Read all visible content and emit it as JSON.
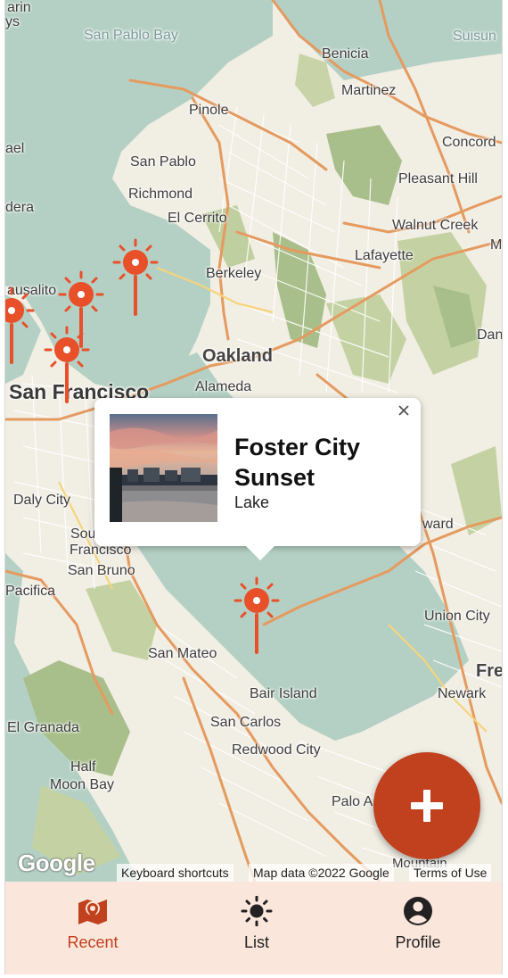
{
  "map": {
    "places": [
      {
        "label": "arin",
        "cls": "sm"
      },
      {
        "label": "ys",
        "cls": "sm"
      },
      {
        "label": "San Pablo Bay",
        "cls": "sm water"
      },
      {
        "label": "Suisun",
        "cls": "sm water"
      },
      {
        "label": "Benicia",
        "cls": "sm"
      },
      {
        "label": "Martinez",
        "cls": "sm"
      },
      {
        "label": "Pinole",
        "cls": "sm"
      },
      {
        "label": "Concord",
        "cls": "sm"
      },
      {
        "label": "ael",
        "cls": "sm"
      },
      {
        "label": "San Pablo",
        "cls": "sm"
      },
      {
        "label": "Pleasant Hill",
        "cls": "sm"
      },
      {
        "label": "Richmond",
        "cls": "sm"
      },
      {
        "label": "dera",
        "cls": "sm"
      },
      {
        "label": "El Cerrito",
        "cls": "sm"
      },
      {
        "label": "Walnut Creek",
        "cls": "sm"
      },
      {
        "label": "M",
        "cls": "sm"
      },
      {
        "label": "Lafayette",
        "cls": "sm"
      },
      {
        "label": "ausalito",
        "cls": "sm"
      },
      {
        "label": "Berkeley",
        "cls": "sm"
      },
      {
        "label": "Dan",
        "cls": "sm"
      },
      {
        "label": "Oakland",
        "cls": "mid"
      },
      {
        "label": "San Francisco",
        "cls": "big"
      },
      {
        "label": "Alameda",
        "cls": "sm"
      },
      {
        "label": "Daly City",
        "cls": "sm"
      },
      {
        "label": "ward",
        "cls": "sm"
      },
      {
        "label": "South",
        "cls": "sm"
      },
      {
        "label": "Francisco",
        "cls": "sm"
      },
      {
        "label": "San Bruno",
        "cls": "sm"
      },
      {
        "label": "Pacifica",
        "cls": "sm"
      },
      {
        "label": "Union City",
        "cls": "sm"
      },
      {
        "label": "San Mateo",
        "cls": "sm"
      },
      {
        "label": "Fre",
        "cls": "mid"
      },
      {
        "label": "Bair Island",
        "cls": "sm"
      },
      {
        "label": "Newark",
        "cls": "sm"
      },
      {
        "label": "El Granada",
        "cls": "sm"
      },
      {
        "label": "San Carlos",
        "cls": "sm"
      },
      {
        "label": "Redwood City",
        "cls": "sm"
      },
      {
        "label": "Half",
        "cls": "sm"
      },
      {
        "label": "Moon Bay",
        "cls": "sm"
      },
      {
        "label": "Palo A",
        "cls": "sm"
      },
      {
        "label": "Mountain",
        "cls": "xs"
      }
    ],
    "pin_color": "#e8502a",
    "google_logo": "Google",
    "attribution": {
      "shortcuts": "Keyboard shortcuts",
      "map_data": "Map data ©2022 Google",
      "terms": "Terms of Use"
    }
  },
  "popup": {
    "title": "Foster City Sunset",
    "subtitle": "Lake",
    "close_icon": "close-icon"
  },
  "fab": {
    "icon": "plus-icon",
    "color": "#c1401e"
  },
  "nav": {
    "background": "#fbe6dc",
    "accent": "#c1401e",
    "items": [
      {
        "label": "Recent",
        "icon": "map-pin-icon",
        "active": true
      },
      {
        "label": "List",
        "icon": "sun-icon",
        "active": false
      },
      {
        "label": "Profile",
        "icon": "account-circle-icon",
        "active": false
      }
    ]
  }
}
